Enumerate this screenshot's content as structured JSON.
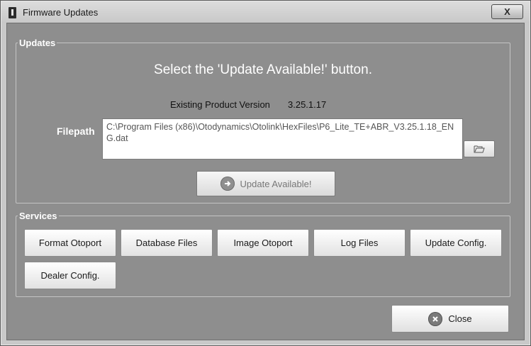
{
  "window": {
    "title": "Firmware Updates",
    "close_glyph": "X"
  },
  "updates": {
    "legend": "Updates",
    "instruction": "Select the 'Update Available!' button.",
    "existing_version_label": "Existing Product Version",
    "existing_version_value": "3.25.1.17",
    "filepath_label": "Filepath",
    "filepath_value": "C:\\Program Files (x86)\\Otodynamics\\Otolink\\HexFiles\\P6_Lite_TE+ABR_V3.25.1.18_ENG.dat",
    "browse_icon": "folder-open-icon",
    "update_button_label": "Update Available!",
    "update_button_icon": "arrow-right-circle-icon",
    "update_button_state": "disabled"
  },
  "services": {
    "legend": "Services",
    "buttons": [
      {
        "label": "Format Otoport"
      },
      {
        "label": "Database Files"
      },
      {
        "label": "Image Otoport"
      },
      {
        "label": "Log Files"
      },
      {
        "label": "Update Config."
      },
      {
        "label": "Dealer Config."
      }
    ]
  },
  "footer": {
    "close_label": "Close",
    "close_icon": "x-circle-icon"
  },
  "colors": {
    "client_background": "#8e8e8e",
    "legend_text": "#ffffff"
  }
}
